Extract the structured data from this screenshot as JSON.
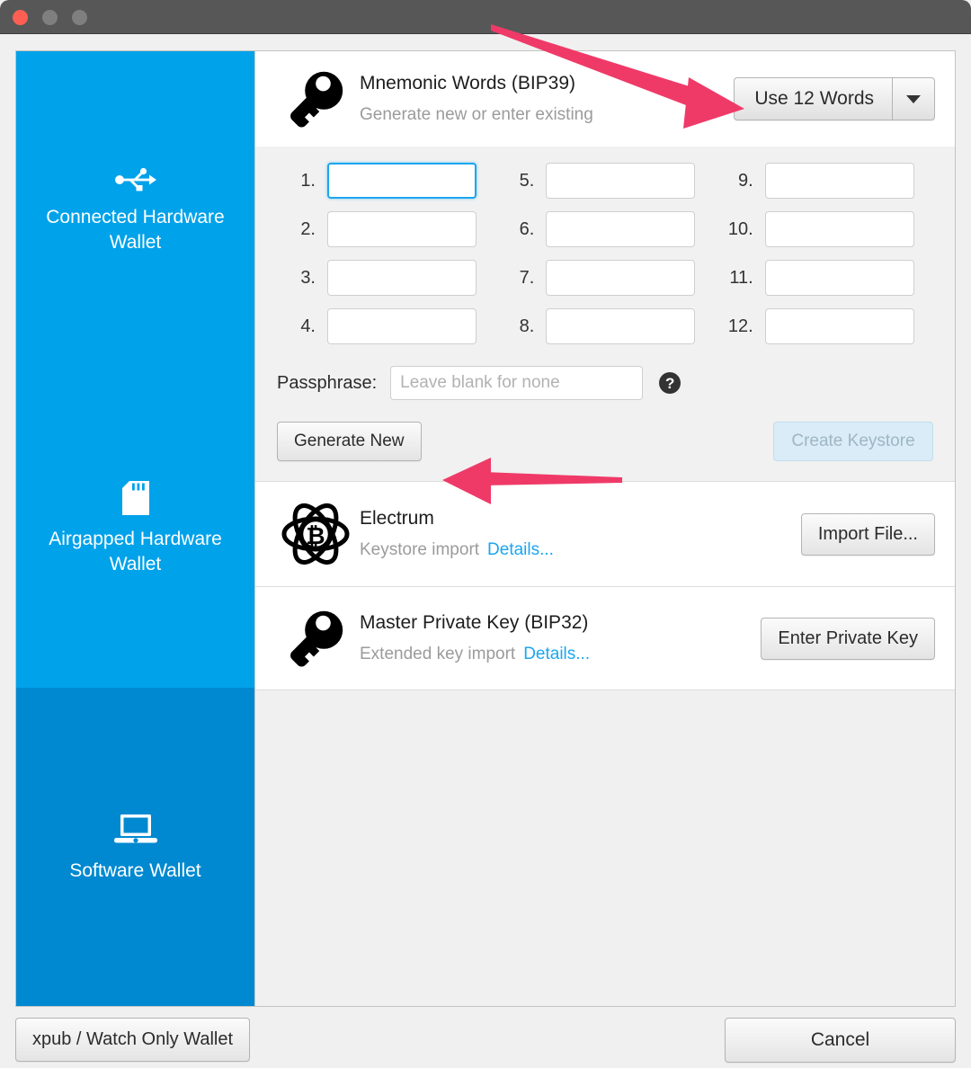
{
  "window": {
    "titlebar": {
      "close_label": "close",
      "minimize_label": "minimize",
      "maximize_label": "maximize"
    },
    "accent_color": "#00a2ea",
    "accent_color_selected": "#0089d0",
    "link_color": "#1ba6ef",
    "annotation_color": "#ef3a68"
  },
  "sidebar": {
    "items": [
      {
        "id": "connected-hardware-wallet",
        "label": "Connected Hardware Wallet",
        "icon": "usb-icon",
        "selected": false
      },
      {
        "id": "airgapped-hardware-wallet",
        "label": "Airgapped Hardware Wallet",
        "icon": "sdcard-icon",
        "selected": false
      },
      {
        "id": "software-wallet",
        "label": "Software Wallet",
        "icon": "laptop-icon",
        "selected": true
      }
    ]
  },
  "main": {
    "mnemonic": {
      "icon": "key-icon",
      "title": "Mnemonic Words (BIP39)",
      "subtitle": "Generate new or enter existing",
      "word_count_button": "Use 12 Words",
      "word_count_caret": "chevron-down-icon",
      "words": [
        {
          "num": "1.",
          "value": "",
          "focused": true
        },
        {
          "num": "2.",
          "value": "",
          "focused": false
        },
        {
          "num": "3.",
          "value": "",
          "focused": false
        },
        {
          "num": "4.",
          "value": "",
          "focused": false
        },
        {
          "num": "5.",
          "value": "",
          "focused": false
        },
        {
          "num": "6.",
          "value": "",
          "focused": false
        },
        {
          "num": "7.",
          "value": "",
          "focused": false
        },
        {
          "num": "8.",
          "value": "",
          "focused": false
        },
        {
          "num": "9.",
          "value": "",
          "focused": false
        },
        {
          "num": "10.",
          "value": "",
          "focused": false
        },
        {
          "num": "11.",
          "value": "",
          "focused": false
        },
        {
          "num": "12.",
          "value": "",
          "focused": false
        }
      ],
      "passphrase_label": "Passphrase:",
      "passphrase_value": "",
      "passphrase_placeholder": "Leave blank for none",
      "help_glyph": "?",
      "generate_button": "Generate New",
      "create_button": "Create Keystore",
      "create_button_disabled": true
    },
    "electrum": {
      "icon": "electrum-atom-icon",
      "title": "Electrum",
      "subtitle": "Keystore import",
      "details_link": "Details...",
      "action_button": "Import File..."
    },
    "master_private_key": {
      "icon": "key-icon",
      "title": "Master Private Key (BIP32)",
      "subtitle": "Extended key import",
      "details_link": "Details...",
      "action_button": "Enter Private Key"
    }
  },
  "footer": {
    "xpub_button": "xpub / Watch Only Wallet",
    "cancel_button": "Cancel"
  },
  "annotations": [
    {
      "id": "arrow-to-word-count",
      "target": "Use 12 Words button",
      "direction": "down-right"
    },
    {
      "id": "arrow-to-generate-new",
      "target": "Generate New button",
      "direction": "left"
    }
  ]
}
